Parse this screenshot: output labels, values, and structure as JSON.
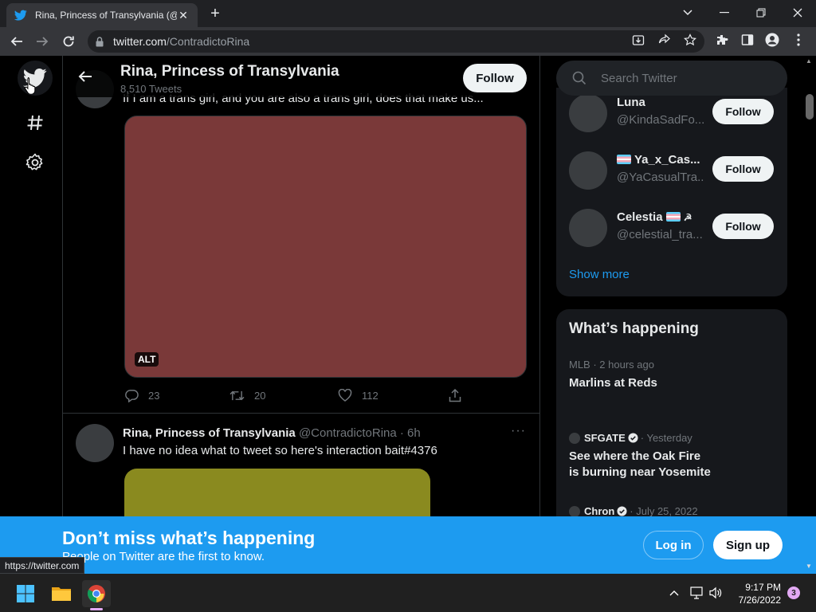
{
  "browser": {
    "tab_title": "Rina, Princess of Transylvania (@C",
    "url_host": "twitter.com",
    "url_path": "/ContradictoRina",
    "status_url": "https://twitter.com"
  },
  "header": {
    "name": "Rina, Princess of Transylvania",
    "tweet_count": "8,510 Tweets",
    "follow_label": "Follow"
  },
  "tweets": [
    {
      "text": "If I am a trans girl, and you are also a trans girl, does that make us...",
      "alt_label": "ALT",
      "media_color": "#7a3939",
      "replies": "23",
      "retweets": "20",
      "likes": "112"
    },
    {
      "name": "Rina, Princess of Transylvania",
      "handle_time": "@ContradictoRina · 6h",
      "more": "···",
      "text": "I have no idea what to tweet so here's interaction bait#4376",
      "media_color": "#8a8a1f"
    }
  ],
  "search": {
    "placeholder": "Search Twitter"
  },
  "who_to_follow": {
    "items": [
      {
        "name": "Luna",
        "handle": "@KindaSadFo...",
        "follow": "Follow"
      },
      {
        "name": "Ya_x_Cas...",
        "handle": "@YaCasualTra...",
        "follow": "Follow"
      },
      {
        "name": "Celestia",
        "handle": "@celestial_tra...",
        "follow": "Follow"
      }
    ],
    "show_more": "Show more"
  },
  "happening": {
    "title": "What’s happening",
    "trends": [
      {
        "meta": "MLB · 2 hours ago",
        "title": "Marlins at Reds"
      },
      {
        "source": "SFGATE",
        "time": "· Yesterday",
        "title": "See where the Oak Fire\nis burning near Yosemite"
      },
      {
        "source": "Chron",
        "time": "· July 25, 2022",
        "title": ""
      }
    ]
  },
  "banner": {
    "headline": "Don’t miss what’s happening",
    "subtext": "People on Twitter are the first to know.",
    "login_label": "Log in",
    "signup_label": "Sign up"
  },
  "taskbar": {
    "time": "9:17 PM",
    "date": "7/26/2022",
    "notification_count": "3"
  },
  "colors": {
    "accent": "#1d9bf0",
    "background": "#000000",
    "sidebar_card": "#16181c"
  }
}
